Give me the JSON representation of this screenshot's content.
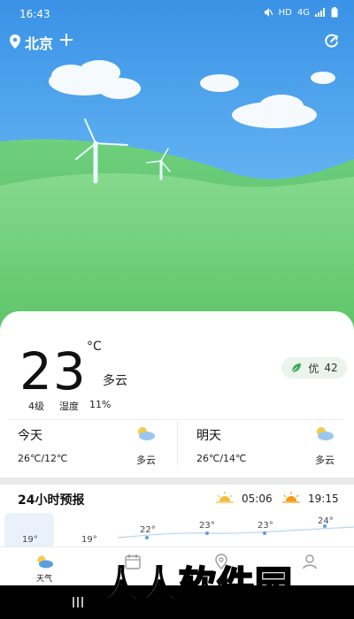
{
  "status_bar": {
    "time": "16:43",
    "net_hd": "HD",
    "net_4g": "4G"
  },
  "header": {
    "city": "北京"
  },
  "current": {
    "temperature": "23",
    "unit": "°C",
    "condition": "多云",
    "wind": "4级",
    "humidity_label": "湿度",
    "humidity_value": "11%",
    "aqi_label": "优",
    "aqi_value": "42"
  },
  "forecast": [
    {
      "day": "今天",
      "range": "26℃/12℃",
      "condition": "多云",
      "icon": "partly-cloudy-icon"
    },
    {
      "day": "明天",
      "range": "26℃/14℃",
      "condition": "多云",
      "icon": "partly-cloudy-icon"
    }
  ],
  "hourly": {
    "title": "24小时预报",
    "sunrise": "05:06",
    "sunset": "19:15",
    "temps": [
      "19°",
      "19°",
      "22°",
      "23°",
      "23°",
      "24°"
    ]
  },
  "nav": [
    {
      "label": "天气",
      "icon": "weather-icon",
      "active": true
    },
    {
      "label": "",
      "icon": "calendar-icon",
      "active": false
    },
    {
      "label": "",
      "icon": "location-icon",
      "active": false
    },
    {
      "label": "",
      "icon": "user-icon",
      "active": false
    }
  ],
  "watermark": "人人软件园",
  "colors": {
    "sky_top": "#3a92e6",
    "hill_green": "#5cc467",
    "accent_blue": "#5b9de3",
    "aqi_green": "#3fa856"
  }
}
